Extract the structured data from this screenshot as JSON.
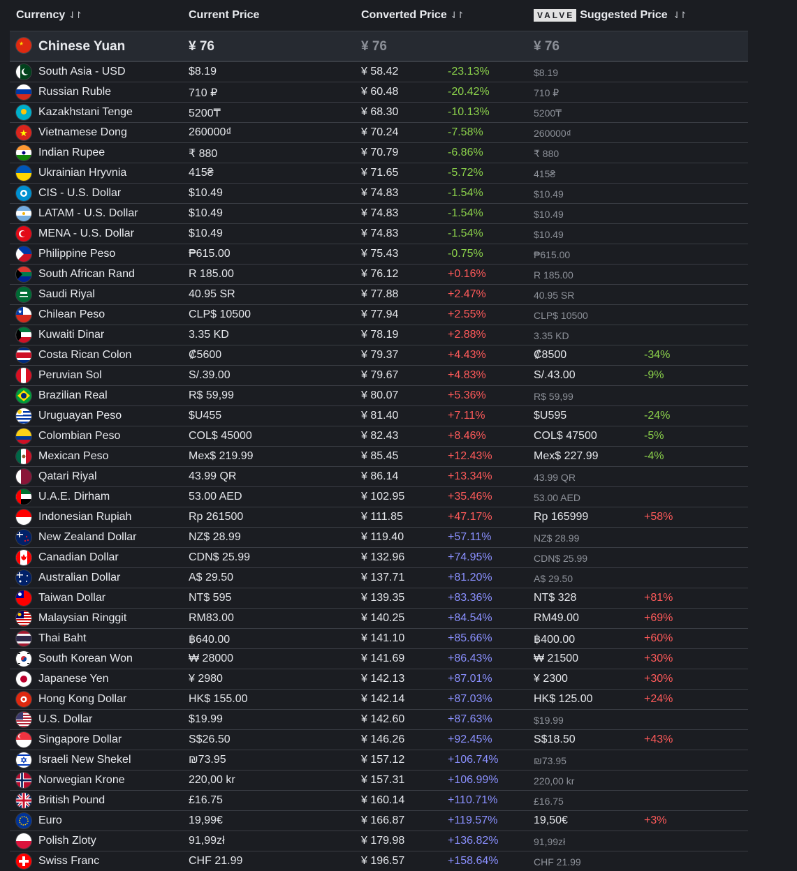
{
  "header": {
    "currency_label": "Currency",
    "current_price_label": "Current Price",
    "converted_price_label": "Converted Price",
    "valve_logo_text": "VALVE",
    "suggested_price_label": "Suggested Price",
    "sort_icon": "⇃↾"
  },
  "colors": {
    "background": "#1b1d22",
    "base_row": "#262a31",
    "negative": "#8bd14b",
    "positive_low": "#ff5a5a",
    "positive_high": "#8a90ff"
  },
  "base_row": {
    "name": "Chinese Yuan",
    "current": "¥ 76",
    "converted": "¥ 76",
    "suggested": "¥ 76",
    "flag": "cn"
  },
  "rows": [
    {
      "name": "South Asia - USD",
      "current": "$8.19",
      "converted": "¥ 58.42",
      "diff": "-23.13%",
      "diff_color": "green",
      "suggested": "$8.19",
      "suggested_diff": "",
      "flag": "pk"
    },
    {
      "name": "Russian Ruble",
      "current": "710 ₽",
      "converted": "¥ 60.48",
      "diff": "-20.42%",
      "diff_color": "green",
      "suggested": "710 ₽",
      "suggested_diff": "",
      "flag": "ru"
    },
    {
      "name": "Kazakhstani Tenge",
      "current": "5200₸",
      "converted": "¥ 68.30",
      "diff": "-10.13%",
      "diff_color": "green",
      "suggested": "5200₸",
      "suggested_diff": "",
      "flag": "kz"
    },
    {
      "name": "Vietnamese Dong",
      "current": "260000₫",
      "converted": "¥ 70.24",
      "diff": "-7.58%",
      "diff_color": "green",
      "suggested": "260000₫",
      "suggested_diff": "",
      "flag": "vn"
    },
    {
      "name": "Indian Rupee",
      "current": "₹ 880",
      "converted": "¥ 70.79",
      "diff": "-6.86%",
      "diff_color": "green",
      "suggested": "₹ 880",
      "suggested_diff": "",
      "flag": "in"
    },
    {
      "name": "Ukrainian Hryvnia",
      "current": "415₴",
      "converted": "¥ 71.65",
      "diff": "-5.72%",
      "diff_color": "green",
      "suggested": "415₴",
      "suggested_diff": "",
      "flag": "ua"
    },
    {
      "name": "CIS - U.S. Dollar",
      "current": "$10.49",
      "converted": "¥ 74.83",
      "diff": "-1.54%",
      "diff_color": "green",
      "suggested": "$10.49",
      "suggested_diff": "",
      "flag": "cis"
    },
    {
      "name": "LATAM - U.S. Dollar",
      "current": "$10.49",
      "converted": "¥ 74.83",
      "diff": "-1.54%",
      "diff_color": "green",
      "suggested": "$10.49",
      "suggested_diff": "",
      "flag": "ar"
    },
    {
      "name": "MENA - U.S. Dollar",
      "current": "$10.49",
      "converted": "¥ 74.83",
      "diff": "-1.54%",
      "diff_color": "green",
      "suggested": "$10.49",
      "suggested_diff": "",
      "flag": "tr"
    },
    {
      "name": "Philippine Peso",
      "current": "₱615.00",
      "converted": "¥ 75.43",
      "diff": "-0.75%",
      "diff_color": "green",
      "suggested": "₱615.00",
      "suggested_diff": "",
      "flag": "ph"
    },
    {
      "name": "South African Rand",
      "current": "R 185.00",
      "converted": "¥ 76.12",
      "diff": "+0.16%",
      "diff_color": "red",
      "suggested": "R 185.00",
      "suggested_diff": "",
      "flag": "za"
    },
    {
      "name": "Saudi Riyal",
      "current": "40.95 SR",
      "converted": "¥ 77.88",
      "diff": "+2.47%",
      "diff_color": "red",
      "suggested": "40.95 SR",
      "suggested_diff": "",
      "flag": "sa"
    },
    {
      "name": "Chilean Peso",
      "current": "CLP$ 10500",
      "converted": "¥ 77.94",
      "diff": "+2.55%",
      "diff_color": "red",
      "suggested": "CLP$ 10500",
      "suggested_diff": "",
      "flag": "cl"
    },
    {
      "name": "Kuwaiti Dinar",
      "current": "3.35 KD",
      "converted": "¥ 78.19",
      "diff": "+2.88%",
      "diff_color": "red",
      "suggested": "3.35 KD",
      "suggested_diff": "",
      "flag": "kw"
    },
    {
      "name": "Costa Rican Colon",
      "current": "₡5600",
      "converted": "¥ 79.37",
      "diff": "+4.43%",
      "diff_color": "red",
      "suggested": "₡8500",
      "suggested_diff": "-34%",
      "sdiff_color": "green",
      "flag": "cr"
    },
    {
      "name": "Peruvian Sol",
      "current": "S/.39.00",
      "converted": "¥ 79.67",
      "diff": "+4.83%",
      "diff_color": "red",
      "suggested": "S/.43.00",
      "suggested_diff": "-9%",
      "sdiff_color": "green",
      "flag": "pe"
    },
    {
      "name": "Brazilian Real",
      "current": "R$ 59,99",
      "converted": "¥ 80.07",
      "diff": "+5.36%",
      "diff_color": "red",
      "suggested": "R$ 59,99",
      "suggested_diff": "",
      "flag": "br"
    },
    {
      "name": "Uruguayan Peso",
      "current": "$U455",
      "converted": "¥ 81.40",
      "diff": "+7.11%",
      "diff_color": "red",
      "suggested": "$U595",
      "suggested_diff": "-24%",
      "sdiff_color": "green",
      "flag": "uy"
    },
    {
      "name": "Colombian Peso",
      "current": "COL$ 45000",
      "converted": "¥ 82.43",
      "diff": "+8.46%",
      "diff_color": "red",
      "suggested": "COL$ 47500",
      "suggested_diff": "-5%",
      "sdiff_color": "green",
      "flag": "co"
    },
    {
      "name": "Mexican Peso",
      "current": "Mex$ 219.99",
      "converted": "¥ 85.45",
      "diff": "+12.43%",
      "diff_color": "red",
      "suggested": "Mex$ 227.99",
      "suggested_diff": "-4%",
      "sdiff_color": "green",
      "flag": "mx"
    },
    {
      "name": "Qatari Riyal",
      "current": "43.99 QR",
      "converted": "¥ 86.14",
      "diff": "+13.34%",
      "diff_color": "red",
      "suggested": "43.99 QR",
      "suggested_diff": "",
      "flag": "qa"
    },
    {
      "name": "U.A.E. Dirham",
      "current": "53.00 AED",
      "converted": "¥ 102.95",
      "diff": "+35.46%",
      "diff_color": "red",
      "suggested": "53.00 AED",
      "suggested_diff": "",
      "flag": "ae"
    },
    {
      "name": "Indonesian Rupiah",
      "current": "Rp 261500",
      "converted": "¥ 111.85",
      "diff": "+47.17%",
      "diff_color": "red",
      "suggested": "Rp 165999",
      "suggested_diff": "+58%",
      "sdiff_color": "red",
      "flag": "id"
    },
    {
      "name": "New Zealand Dollar",
      "current": "NZ$ 28.99",
      "converted": "¥ 119.40",
      "diff": "+57.11%",
      "diff_color": "blue",
      "suggested": "NZ$ 28.99",
      "suggested_diff": "",
      "flag": "nz"
    },
    {
      "name": "Canadian Dollar",
      "current": "CDN$ 25.99",
      "converted": "¥ 132.96",
      "diff": "+74.95%",
      "diff_color": "blue",
      "suggested": "CDN$ 25.99",
      "suggested_diff": "",
      "flag": "ca"
    },
    {
      "name": "Australian Dollar",
      "current": "A$ 29.50",
      "converted": "¥ 137.71",
      "diff": "+81.20%",
      "diff_color": "blue",
      "suggested": "A$ 29.50",
      "suggested_diff": "",
      "flag": "au"
    },
    {
      "name": "Taiwan Dollar",
      "current": "NT$ 595",
      "converted": "¥ 139.35",
      "diff": "+83.36%",
      "diff_color": "blue",
      "suggested": "NT$ 328",
      "suggested_diff": "+81%",
      "sdiff_color": "red",
      "flag": "tw"
    },
    {
      "name": "Malaysian Ringgit",
      "current": "RM83.00",
      "converted": "¥ 140.25",
      "diff": "+84.54%",
      "diff_color": "blue",
      "suggested": "RM49.00",
      "suggested_diff": "+69%",
      "sdiff_color": "red",
      "flag": "my"
    },
    {
      "name": "Thai Baht",
      "current": "฿640.00",
      "converted": "¥ 141.10",
      "diff": "+85.66%",
      "diff_color": "blue",
      "suggested": "฿400.00",
      "suggested_diff": "+60%",
      "sdiff_color": "red",
      "flag": "th"
    },
    {
      "name": "South Korean Won",
      "current": "₩ 28000",
      "converted": "¥ 141.69",
      "diff": "+86.43%",
      "diff_color": "blue",
      "suggested": "₩ 21500",
      "suggested_diff": "+30%",
      "sdiff_color": "red",
      "flag": "kr"
    },
    {
      "name": "Japanese Yen",
      "current": "¥ 2980",
      "converted": "¥ 142.13",
      "diff": "+87.01%",
      "diff_color": "blue",
      "suggested": "¥ 2300",
      "suggested_diff": "+30%",
      "sdiff_color": "red",
      "flag": "jp"
    },
    {
      "name": "Hong Kong Dollar",
      "current": "HK$ 155.00",
      "converted": "¥ 142.14",
      "diff": "+87.03%",
      "diff_color": "blue",
      "suggested": "HK$ 125.00",
      "suggested_diff": "+24%",
      "sdiff_color": "red",
      "flag": "hk"
    },
    {
      "name": "U.S. Dollar",
      "current": "$19.99",
      "converted": "¥ 142.60",
      "diff": "+87.63%",
      "diff_color": "blue",
      "suggested": "$19.99",
      "suggested_diff": "",
      "flag": "us"
    },
    {
      "name": "Singapore Dollar",
      "current": "S$26.50",
      "converted": "¥ 146.26",
      "diff": "+92.45%",
      "diff_color": "blue",
      "suggested": "S$18.50",
      "suggested_diff": "+43%",
      "sdiff_color": "red",
      "flag": "sg"
    },
    {
      "name": "Israeli New Shekel",
      "current": "₪73.95",
      "converted": "¥ 157.12",
      "diff": "+106.74%",
      "diff_color": "blue",
      "suggested": "₪73.95",
      "suggested_diff": "",
      "flag": "il"
    },
    {
      "name": "Norwegian Krone",
      "current": "220,00 kr",
      "converted": "¥ 157.31",
      "diff": "+106.99%",
      "diff_color": "blue",
      "suggested": "220,00 kr",
      "suggested_diff": "",
      "flag": "no"
    },
    {
      "name": "British Pound",
      "current": "£16.75",
      "converted": "¥ 160.14",
      "diff": "+110.71%",
      "diff_color": "blue",
      "suggested": "£16.75",
      "suggested_diff": "",
      "flag": "gb"
    },
    {
      "name": "Euro",
      "current": "19,99€",
      "converted": "¥ 166.87",
      "diff": "+119.57%",
      "diff_color": "blue",
      "suggested": "19,50€",
      "suggested_diff": "+3%",
      "sdiff_color": "red",
      "flag": "eu"
    },
    {
      "name": "Polish Zloty",
      "current": "91,99zł",
      "converted": "¥ 179.98",
      "diff": "+136.82%",
      "diff_color": "blue",
      "suggested": "91,99zł",
      "suggested_diff": "",
      "flag": "pl"
    },
    {
      "name": "Swiss Franc",
      "current": "CHF 21.99",
      "converted": "¥ 196.57",
      "diff": "+158.64%",
      "diff_color": "blue",
      "suggested": "CHF 21.99",
      "suggested_diff": "",
      "flag": "ch"
    }
  ]
}
